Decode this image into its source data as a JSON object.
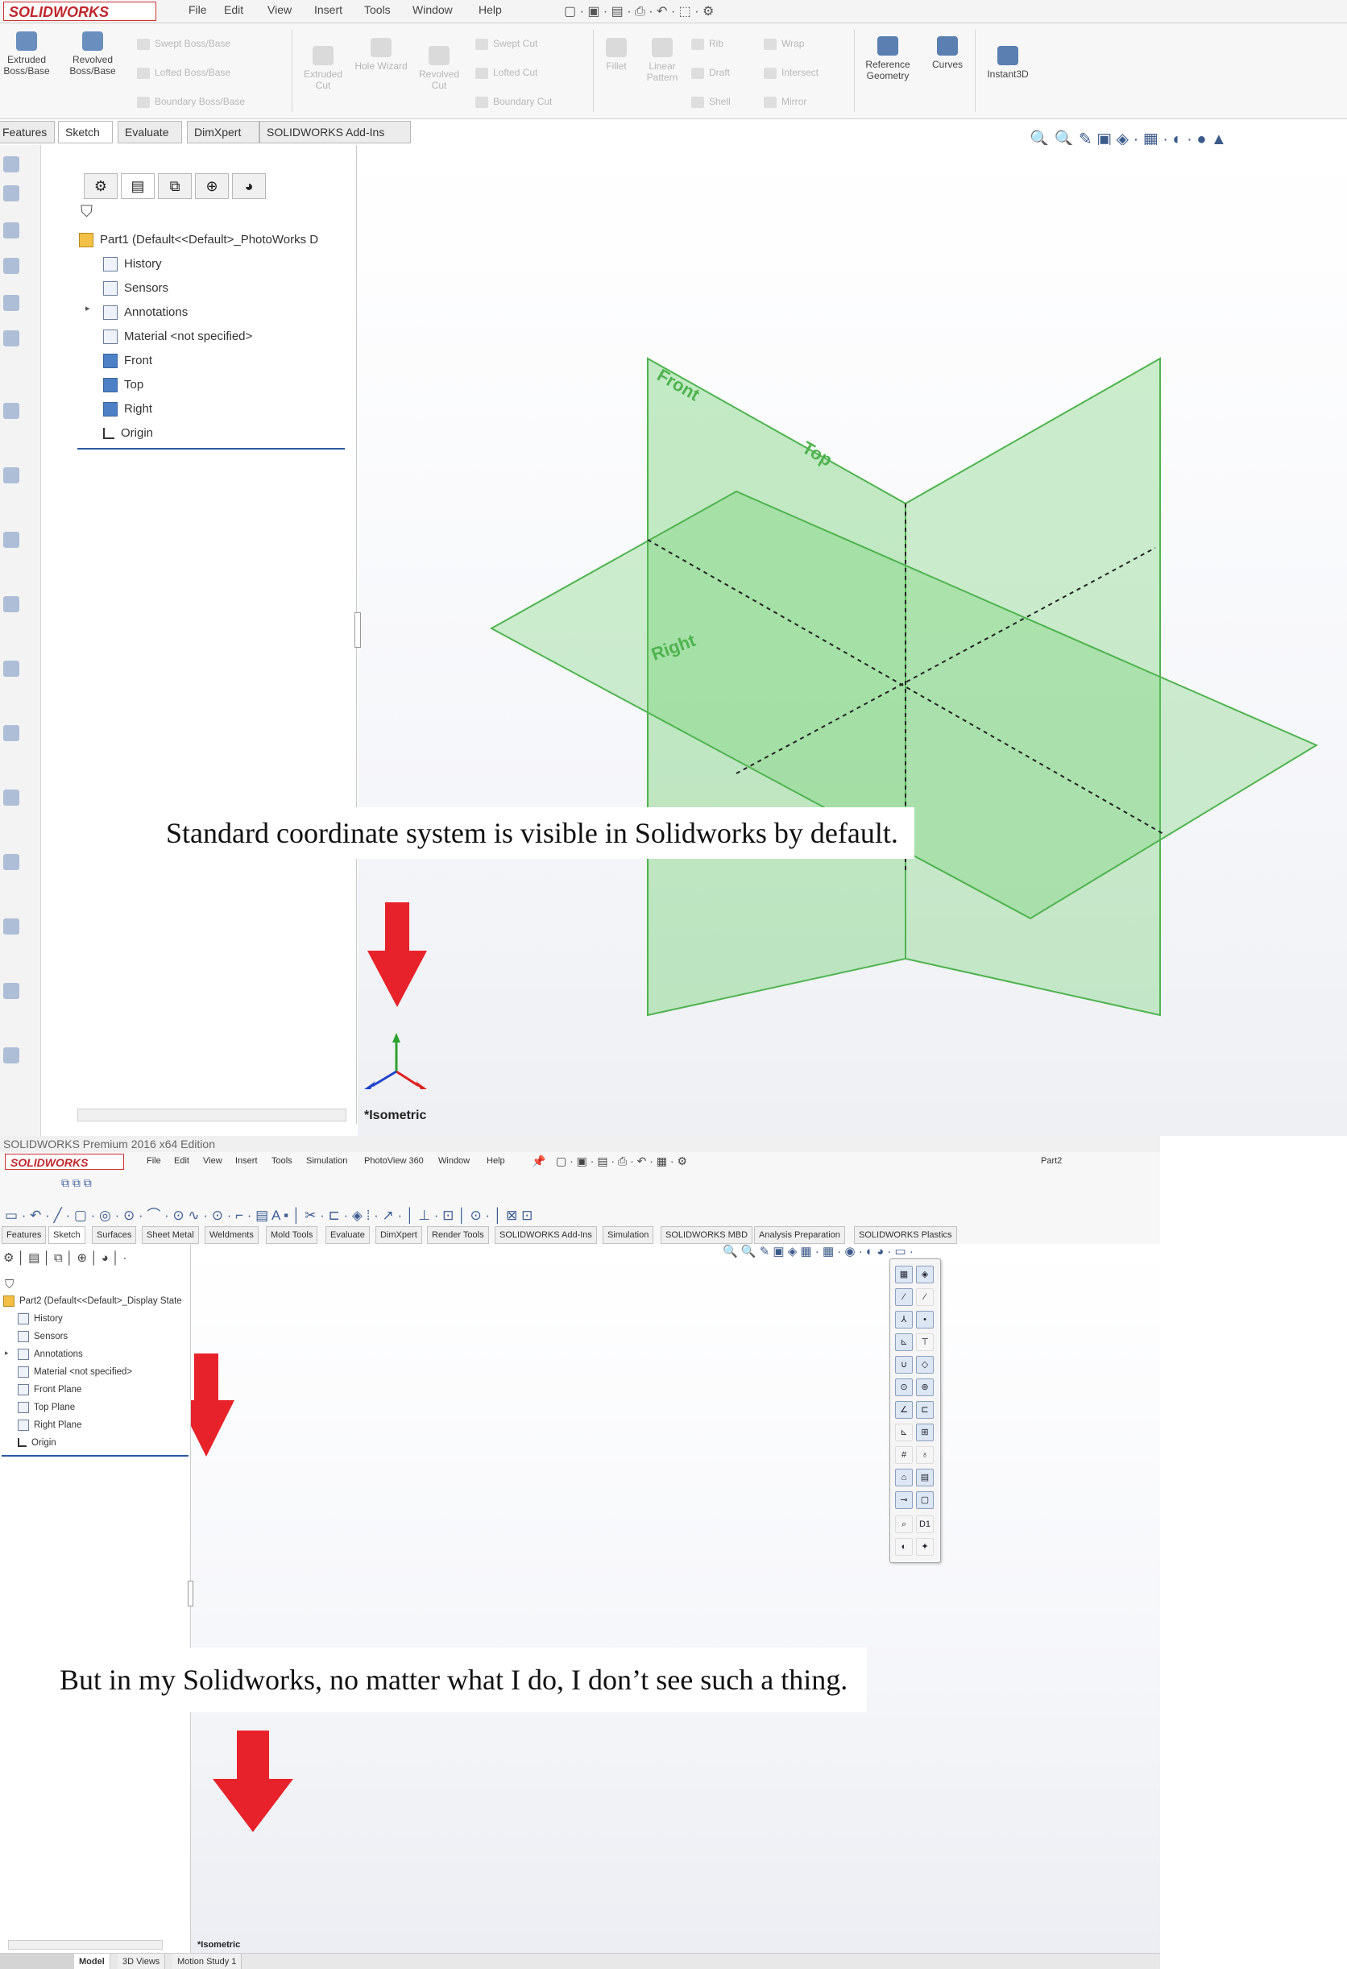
{
  "shot1": {
    "logo_text": "SOLIDWORKS",
    "menu": [
      "File",
      "Edit",
      "View",
      "Insert",
      "Tools",
      "Window",
      "Help"
    ],
    "ribbon": {
      "large_buttons": [
        "Extruded Boss/Base",
        "Revolved Boss/Base",
        "Extruded Cut",
        "Hole Wizard",
        "Revolved Cut",
        "Fillet",
        "Linear Pattern",
        "Reference Geometry",
        "Curves",
        "Instant3D"
      ],
      "small_buttons": [
        "Swept Boss/Base",
        "Lofted Boss/Base",
        "Boundary Boss/Base",
        "Swept Cut",
        "Lofted Cut",
        "Boundary Cut",
        "Rib",
        "Draft",
        "Shell",
        "Wrap",
        "Intersect",
        "Mirror"
      ]
    },
    "tabs": [
      "Features",
      "Sketch",
      "Evaluate",
      "DimXpert",
      "SOLIDWORKS Add-Ins"
    ],
    "tree": {
      "part": "Part1  (Default<<Default>_PhotoWorks D",
      "items": [
        "History",
        "Sensors",
        "Annotations",
        "Material <not specified>",
        "Front",
        "Top",
        "Right",
        "Origin"
      ]
    },
    "planes": {
      "front": "Front",
      "top": "Top",
      "right": "Right",
      "color": "#66cc66"
    },
    "view_label": "*Isometric",
    "annotation": "Standard coordinate system is visible in Solidworks by default.",
    "arrow_color": "#e8222a"
  },
  "shot2": {
    "title_bar": "SOLIDWORKS Premium 2016 x64 Edition",
    "logo_text": "SOLIDWORKS",
    "menu": [
      "File",
      "Edit",
      "View",
      "Insert",
      "Tools",
      "Simulation",
      "PhotoView 360",
      "Window",
      "Help"
    ],
    "doc_title": "Part2",
    "tabs": [
      "Features",
      "Sketch",
      "Surfaces",
      "Sheet Metal",
      "Weldments",
      "Mold Tools",
      "Evaluate",
      "DimXpert",
      "Render Tools",
      "SOLIDWORKS Add-Ins",
      "Simulation",
      "SOLIDWORKS MBD",
      "Analysis Preparation",
      "SOLIDWORKS Plastics"
    ],
    "tree": {
      "part": "Part2  (Default<<Default>_Display State",
      "items": [
        "History",
        "Sensors",
        "Annotations",
        "Material <not specified>",
        "Front Plane",
        "Top Plane",
        "Right Plane",
        "Origin"
      ]
    },
    "view_label": "*Isometric",
    "bottom_tabs": [
      "Model",
      "3D Views",
      "Motion Study 1"
    ],
    "vtool_d1": "D1",
    "annotation": "But in my Solidworks, no matter what I do, I don’t see such a thing."
  }
}
